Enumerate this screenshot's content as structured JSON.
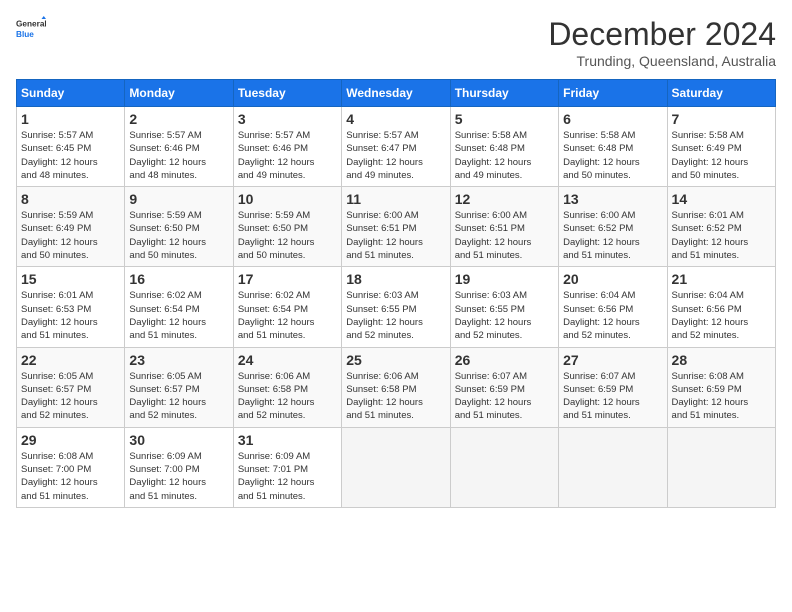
{
  "logo": {
    "line1": "General",
    "line2": "Blue"
  },
  "title": "December 2024",
  "subtitle": "Trunding, Queensland, Australia",
  "weekdays": [
    "Sunday",
    "Monday",
    "Tuesday",
    "Wednesday",
    "Thursday",
    "Friday",
    "Saturday"
  ],
  "weeks": [
    [
      {
        "day": "1",
        "info": "Sunrise: 5:57 AM\nSunset: 6:45 PM\nDaylight: 12 hours\nand 48 minutes."
      },
      {
        "day": "2",
        "info": "Sunrise: 5:57 AM\nSunset: 6:46 PM\nDaylight: 12 hours\nand 48 minutes."
      },
      {
        "day": "3",
        "info": "Sunrise: 5:57 AM\nSunset: 6:46 PM\nDaylight: 12 hours\nand 49 minutes."
      },
      {
        "day": "4",
        "info": "Sunrise: 5:57 AM\nSunset: 6:47 PM\nDaylight: 12 hours\nand 49 minutes."
      },
      {
        "day": "5",
        "info": "Sunrise: 5:58 AM\nSunset: 6:48 PM\nDaylight: 12 hours\nand 49 minutes."
      },
      {
        "day": "6",
        "info": "Sunrise: 5:58 AM\nSunset: 6:48 PM\nDaylight: 12 hours\nand 50 minutes."
      },
      {
        "day": "7",
        "info": "Sunrise: 5:58 AM\nSunset: 6:49 PM\nDaylight: 12 hours\nand 50 minutes."
      }
    ],
    [
      {
        "day": "8",
        "info": "Sunrise: 5:59 AM\nSunset: 6:49 PM\nDaylight: 12 hours\nand 50 minutes."
      },
      {
        "day": "9",
        "info": "Sunrise: 5:59 AM\nSunset: 6:50 PM\nDaylight: 12 hours\nand 50 minutes."
      },
      {
        "day": "10",
        "info": "Sunrise: 5:59 AM\nSunset: 6:50 PM\nDaylight: 12 hours\nand 50 minutes."
      },
      {
        "day": "11",
        "info": "Sunrise: 6:00 AM\nSunset: 6:51 PM\nDaylight: 12 hours\nand 51 minutes."
      },
      {
        "day": "12",
        "info": "Sunrise: 6:00 AM\nSunset: 6:51 PM\nDaylight: 12 hours\nand 51 minutes."
      },
      {
        "day": "13",
        "info": "Sunrise: 6:00 AM\nSunset: 6:52 PM\nDaylight: 12 hours\nand 51 minutes."
      },
      {
        "day": "14",
        "info": "Sunrise: 6:01 AM\nSunset: 6:52 PM\nDaylight: 12 hours\nand 51 minutes."
      }
    ],
    [
      {
        "day": "15",
        "info": "Sunrise: 6:01 AM\nSunset: 6:53 PM\nDaylight: 12 hours\nand 51 minutes."
      },
      {
        "day": "16",
        "info": "Sunrise: 6:02 AM\nSunset: 6:54 PM\nDaylight: 12 hours\nand 51 minutes."
      },
      {
        "day": "17",
        "info": "Sunrise: 6:02 AM\nSunset: 6:54 PM\nDaylight: 12 hours\nand 51 minutes."
      },
      {
        "day": "18",
        "info": "Sunrise: 6:03 AM\nSunset: 6:55 PM\nDaylight: 12 hours\nand 52 minutes."
      },
      {
        "day": "19",
        "info": "Sunrise: 6:03 AM\nSunset: 6:55 PM\nDaylight: 12 hours\nand 52 minutes."
      },
      {
        "day": "20",
        "info": "Sunrise: 6:04 AM\nSunset: 6:56 PM\nDaylight: 12 hours\nand 52 minutes."
      },
      {
        "day": "21",
        "info": "Sunrise: 6:04 AM\nSunset: 6:56 PM\nDaylight: 12 hours\nand 52 minutes."
      }
    ],
    [
      {
        "day": "22",
        "info": "Sunrise: 6:05 AM\nSunset: 6:57 PM\nDaylight: 12 hours\nand 52 minutes."
      },
      {
        "day": "23",
        "info": "Sunrise: 6:05 AM\nSunset: 6:57 PM\nDaylight: 12 hours\nand 52 minutes."
      },
      {
        "day": "24",
        "info": "Sunrise: 6:06 AM\nSunset: 6:58 PM\nDaylight: 12 hours\nand 52 minutes."
      },
      {
        "day": "25",
        "info": "Sunrise: 6:06 AM\nSunset: 6:58 PM\nDaylight: 12 hours\nand 51 minutes."
      },
      {
        "day": "26",
        "info": "Sunrise: 6:07 AM\nSunset: 6:59 PM\nDaylight: 12 hours\nand 51 minutes."
      },
      {
        "day": "27",
        "info": "Sunrise: 6:07 AM\nSunset: 6:59 PM\nDaylight: 12 hours\nand 51 minutes."
      },
      {
        "day": "28",
        "info": "Sunrise: 6:08 AM\nSunset: 6:59 PM\nDaylight: 12 hours\nand 51 minutes."
      }
    ],
    [
      {
        "day": "29",
        "info": "Sunrise: 6:08 AM\nSunset: 7:00 PM\nDaylight: 12 hours\nand 51 minutes."
      },
      {
        "day": "30",
        "info": "Sunrise: 6:09 AM\nSunset: 7:00 PM\nDaylight: 12 hours\nand 51 minutes."
      },
      {
        "day": "31",
        "info": "Sunrise: 6:09 AM\nSunset: 7:01 PM\nDaylight: 12 hours\nand 51 minutes."
      },
      null,
      null,
      null,
      null
    ]
  ]
}
